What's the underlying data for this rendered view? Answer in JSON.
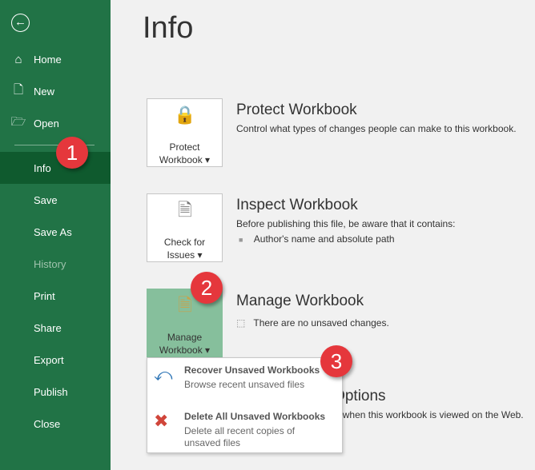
{
  "sidebar": {
    "items": [
      {
        "label": "Home",
        "icon": "home-icon"
      },
      {
        "label": "New",
        "icon": "new-document-icon"
      },
      {
        "label": "Open",
        "icon": "folder-open-icon"
      },
      {
        "label": "Info"
      },
      {
        "label": "Save"
      },
      {
        "label": "Save As"
      },
      {
        "label": "History"
      },
      {
        "label": "Print"
      },
      {
        "label": "Share"
      },
      {
        "label": "Export"
      },
      {
        "label": "Publish"
      },
      {
        "label": "Close"
      }
    ]
  },
  "title": "Info",
  "badges": [
    "1",
    "2",
    "3"
  ],
  "protect": {
    "button_line1": "Protect",
    "button_line2": "Workbook",
    "title": "Protect Workbook",
    "desc": "Control what types of changes people can make to this workbook."
  },
  "inspect": {
    "button_line1": "Check for",
    "button_line2": "Issues",
    "title": "Inspect Workbook",
    "desc": "Before publishing this file, be aware that it contains:",
    "bullet": "Author's name and absolute path"
  },
  "manage": {
    "button_line1": "Manage",
    "button_line2": "Workbook",
    "title": "Manage Workbook",
    "desc": "There are no unsaved changes."
  },
  "browser": {
    "title": "Browser View Options",
    "desc": "Pick what users can see when this workbook is viewed on the Web."
  },
  "menu": [
    {
      "title": "Recover Unsaved Workbooks",
      "desc": "Browse recent unsaved files"
    },
    {
      "title": "Delete All Unsaved Workbooks",
      "desc": "Delete all recent copies of unsaved files"
    }
  ]
}
